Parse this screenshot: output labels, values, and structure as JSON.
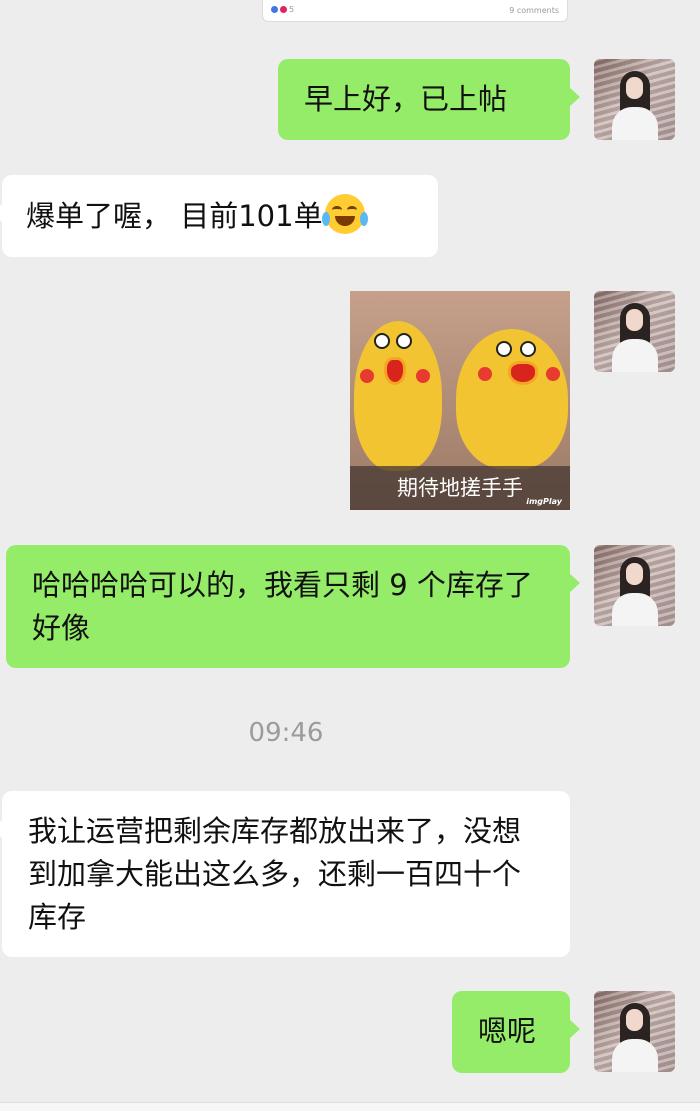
{
  "shared_card": {
    "reaction_count": "5",
    "comments": "9 comments"
  },
  "messages": [
    {
      "sender": "me",
      "text": "早上好，已上帖"
    },
    {
      "sender": "other",
      "text": "爆单了喔， 目前101单",
      "emoji": "tears-of-joy-emoji"
    },
    {
      "sender": "me",
      "type": "sticker",
      "caption": "期待地搓手手",
      "watermark": "imgPlay"
    },
    {
      "sender": "me",
      "text": "哈哈哈哈可以的，我看只剩 9 个库存了好像"
    },
    {
      "sender": "other",
      "text": "我让运营把剩余库存都放出来了，没想到加拿大能出这么多，还剩一百四十个库存"
    },
    {
      "sender": "me",
      "text": "嗯呢"
    }
  ],
  "timestamp": "09:46",
  "colors": {
    "background": "#ededed",
    "my_bubble": "#95ec69",
    "their_bubble": "#ffffff",
    "timestamp_text": "#9b9b9b"
  }
}
